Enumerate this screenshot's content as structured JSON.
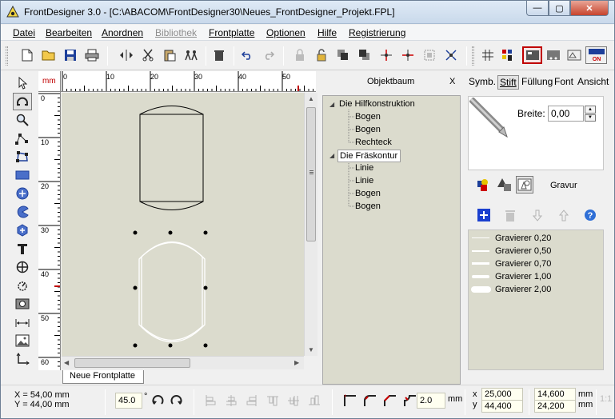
{
  "window": {
    "title": "FrontDesigner 3.0 - [C:\\ABACOM\\FrontDesigner30\\Neues_FrontDesigner_Projekt.FPL]",
    "min_glyph": "—",
    "max_glyph": "▢",
    "close_glyph": "✕"
  },
  "menu": {
    "items": [
      {
        "label": "Datei",
        "enabled": true
      },
      {
        "label": "Bearbeiten",
        "enabled": true
      },
      {
        "label": "Anordnen",
        "enabled": true
      },
      {
        "label": "Bibliothek",
        "enabled": false
      },
      {
        "label": "Frontplatte",
        "enabled": true
      },
      {
        "label": "Optionen",
        "enabled": true
      },
      {
        "label": "Hilfe",
        "enabled": true
      },
      {
        "label": "Registrierung",
        "enabled": true
      }
    ]
  },
  "toolbar": {
    "icons": [
      "new-file-icon",
      "open-folder-icon",
      "save-icon",
      "print-icon",
      "flip-horizontal-icon",
      "cut-icon",
      "paste-icon",
      "duplicate-icon",
      "delete-icon",
      "undo-icon",
      "redo-icon",
      "lock-icon",
      "unlock-icon",
      "bring-front-icon",
      "send-back-icon",
      "align-center-icon",
      "center-cross-icon",
      "group-icon",
      "ungroup-icon",
      "grid-icon",
      "colors-icon",
      "view-mode-1-icon",
      "view-mode-2-icon",
      "view-mode-3-icon",
      "toggle-on-icon"
    ],
    "on_label": "ON"
  },
  "tools": [
    "pointer-icon",
    "arc-tool-icon",
    "zoom-icon",
    "polyline-icon",
    "polygon-icon",
    "rectangle-icon",
    "circle-icon",
    "pie-icon",
    "hexagon-icon",
    "text-icon",
    "crosshair-icon",
    "gear-scale-icon",
    "hole-icon",
    "dimension-icon",
    "image-icon",
    "axis-icon"
  ],
  "ruler": {
    "unit": "mm",
    "h_labels": [
      "0",
      "10",
      "20",
      "30",
      "40",
      "50"
    ],
    "v_labels": [
      "0",
      "10",
      "20",
      "30",
      "40",
      "50",
      "60"
    ]
  },
  "canvas": {
    "tab_label": "Neue Frontplatte"
  },
  "objtree": {
    "title": "Objektbaum",
    "close": "X",
    "groups": [
      {
        "label": "Die Hilfkonstruktion",
        "children": [
          "Bogen",
          "Bogen",
          "Rechteck"
        ]
      },
      {
        "label": "Die Fräskontur",
        "children": [
          "Linie",
          "Linie",
          "Bogen",
          "Bogen"
        ]
      }
    ]
  },
  "props": {
    "tabs": [
      {
        "label": "Symb.",
        "selected": false
      },
      {
        "label": "Stift",
        "selected": true
      },
      {
        "label": "Füllung",
        "selected": false
      },
      {
        "label": "Font",
        "selected": false
      },
      {
        "label": "Ansicht",
        "selected": false
      }
    ],
    "breite_label": "Breite:",
    "breite_value": "0,00",
    "gravur_label": "Gravur",
    "pens": [
      {
        "label": "Gravierer 0,20",
        "width": 0.2
      },
      {
        "label": "Gravierer 0,50",
        "width": 0.5
      },
      {
        "label": "Gravierer 0,70",
        "width": 0.7
      },
      {
        "label": "Gravierer 1,00",
        "width": 1.0
      },
      {
        "label": "Gravierer 2,00",
        "width": 2.0
      }
    ]
  },
  "status": {
    "x_coord": "X = 54,00 mm",
    "y_coord": "Y = 44,00 mm",
    "angle": "45.0",
    "degree": "°",
    "corner": "2.0",
    "corner_unit": "mm",
    "pos_x_label": "x",
    "pos_x": "25,000",
    "pos_y_label": "y",
    "pos_y": "44,400",
    "size_w": "14,600",
    "size_h": "24,200",
    "size_unit_w": "mm",
    "size_unit_h": "mm",
    "scale_hint": "1:1"
  },
  "colors": {
    "canvas_bg": "#dbdbcd",
    "accent_red": "#c00000",
    "add_blue": "#1a3fcf"
  }
}
